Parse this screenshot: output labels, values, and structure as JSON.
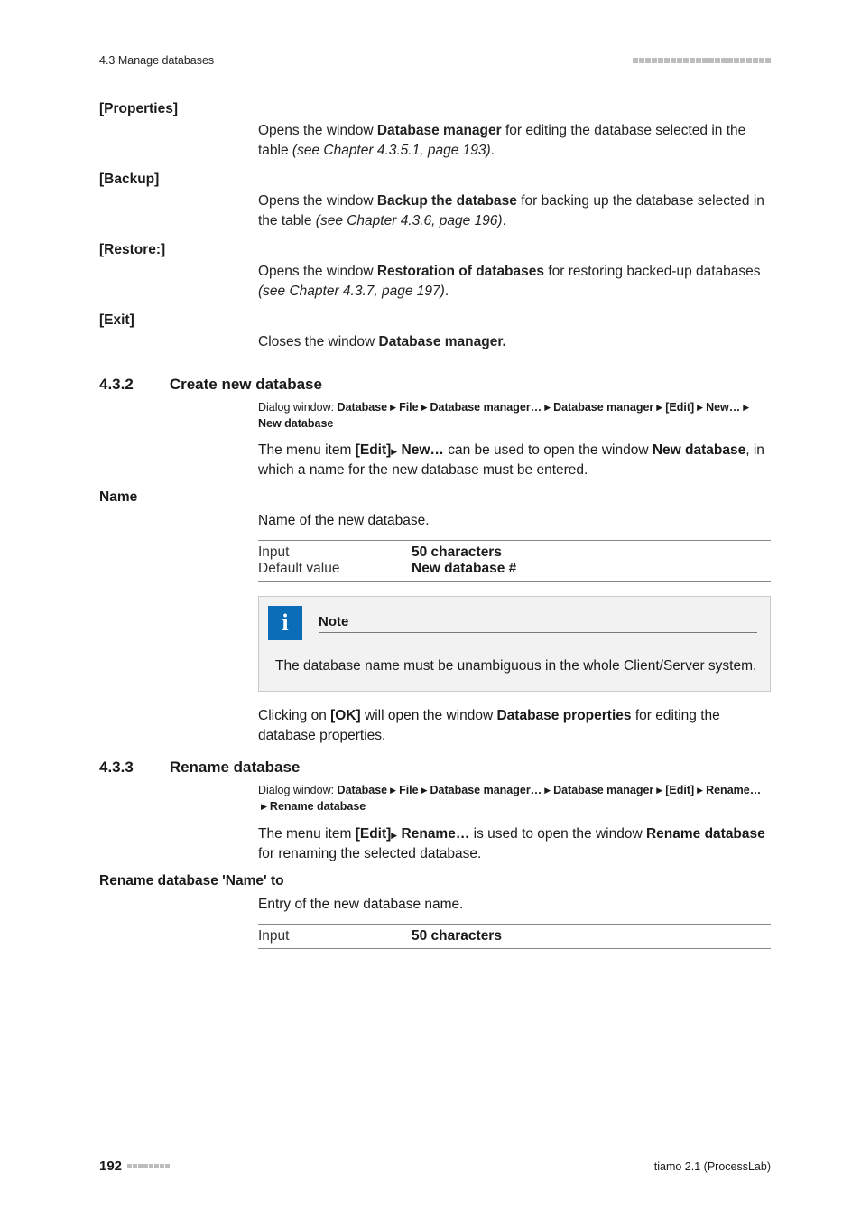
{
  "header": {
    "section": "4.3 Manage databases"
  },
  "items": {
    "properties": {
      "term": "[Properties]",
      "p1a": "Opens the window ",
      "p1b": "Database manager",
      "p1c": " for editing the database selected in the table ",
      "p1d": "(see Chapter 4.3.5.1, page 193)",
      "p1e": "."
    },
    "backup": {
      "term": "[Backup]",
      "p1a": "Opens the window ",
      "p1b": "Backup the database",
      "p1c": " for backing up the database selected in the table ",
      "p1d": "(see Chapter 4.3.6, page 196)",
      "p1e": "."
    },
    "restore": {
      "term": "[Restore:]",
      "p1a": "Opens the window ",
      "p1b": "Restoration of databases",
      "p1c": " for restoring backed-up databases ",
      "p1d": "(see Chapter 4.3.7, page 197)",
      "p1e": "."
    },
    "exit": {
      "term": "[Exit]",
      "p1a": "Closes the window ",
      "p1b": "Database manager."
    }
  },
  "s432": {
    "num": "4.3.2",
    "title": "Create new database",
    "path_prefix": "Dialog window: ",
    "path": [
      "Database",
      "File",
      "Database manager…",
      "Database manager",
      "[Edit]",
      "New…",
      "New database"
    ],
    "para1a": "The menu item ",
    "para1b": "[Edit]",
    "para1c": "New…",
    "para1d": " can be used to open the window ",
    "para1e": "New database",
    "para1f": ", in which a name for the new database must be entered.",
    "field_label": "Name",
    "field_desc": "Name of the new database.",
    "spec": {
      "k1": "Input",
      "v1": "50 characters",
      "k2": "Default value",
      "v2": "New database #"
    },
    "note_title": "Note",
    "note_body": "The database name must be unambiguous in the whole Client/Server system.",
    "after_note_a": "Clicking on ",
    "after_note_b": "[OK]",
    "after_note_c": " will open the window ",
    "after_note_d": "Database properties",
    "after_note_e": " for editing the database properties."
  },
  "s433": {
    "num": "4.3.3",
    "title": "Rename database",
    "path_prefix": "Dialog window: ",
    "path": [
      "Database",
      "File",
      "Database manager…",
      "Database manager",
      "[Edit]",
      "Rename…",
      "Rename database"
    ],
    "para1a": "The menu item ",
    "para1b": "[Edit]",
    "para1c": "Rename…",
    "para1d": " is used to open the window ",
    "para1e": "Rename database",
    "para1f": " for renaming the selected database.",
    "field_label": "Rename database 'Name' to",
    "field_desc": "Entry of the new database name.",
    "spec": {
      "k1": "Input",
      "v1": "50 characters"
    }
  },
  "footer": {
    "page": "192",
    "product": "tiamo 2.1 (ProcessLab)"
  }
}
